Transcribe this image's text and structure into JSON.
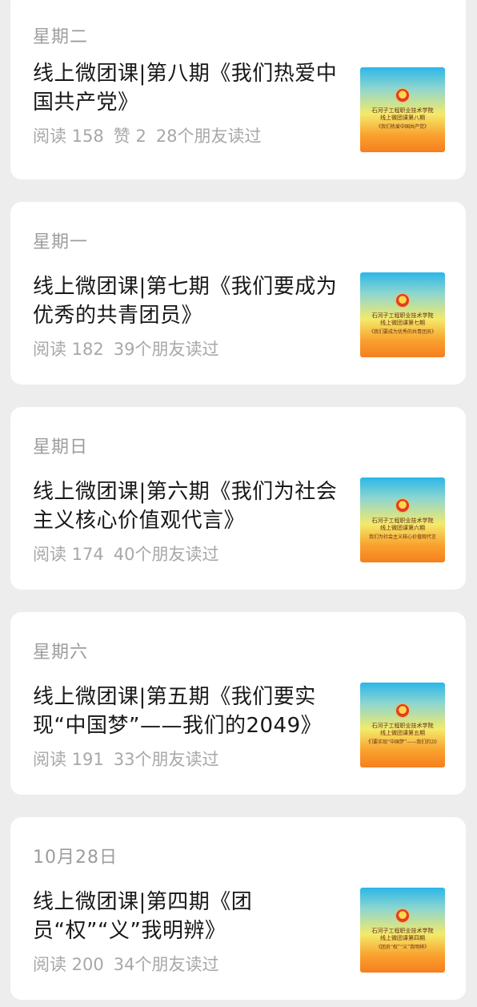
{
  "articles": [
    {
      "date": "星期二",
      "title": "线上微团课|第八期《我们热爱中国共产党》",
      "reads": "阅读 158",
      "likes": "赞 2",
      "friends": "28个朋友读过",
      "thumb": {
        "line1": "石河子工程职业技术学院",
        "line2": "线上微团课第八期",
        "line3": "《我们热爱中国共产党》"
      }
    },
    {
      "date": "星期一",
      "title": "线上微团课|第七期《我们要成为优秀的共青团员》",
      "reads": "阅读 182",
      "friends": "39个朋友读过",
      "thumb": {
        "line1": "石河子工程职业技术学院",
        "line2": "线上微团课第七期",
        "line3": "《我们要成为优秀的共青团员》"
      }
    },
    {
      "date": "星期日",
      "title": "线上微团课|第六期《我们为社会主义核心价值观代言》",
      "reads": "阅读 174",
      "friends": "40个朋友读过",
      "thumb": {
        "line1": "石河子工程职业技术学院",
        "line2": "线上微团课第六期",
        "line3": "我们为社会主义核心价值观代言"
      }
    },
    {
      "date": "星期六",
      "title": "线上微团课|第五期《我们要实现“中国梦”——我们的2049》",
      "reads": "阅读 191",
      "friends": "33个朋友读过",
      "thumb": {
        "line1": "石河子工程职业技术学院",
        "line2": "线上微团课第五期",
        "line3": "们要实现“中国梦”——我们的20"
      }
    },
    {
      "date": "10月28日",
      "title": "线上微团课|第四期《团员“权”“义”我明辨》",
      "reads": "阅读 200",
      "friends": "34个朋友读过",
      "thumb": {
        "line1": "石河子工程职业技术学院",
        "line2": "线上微团课第四期",
        "line3": "《团员“权”“义”我明辨》"
      }
    }
  ]
}
